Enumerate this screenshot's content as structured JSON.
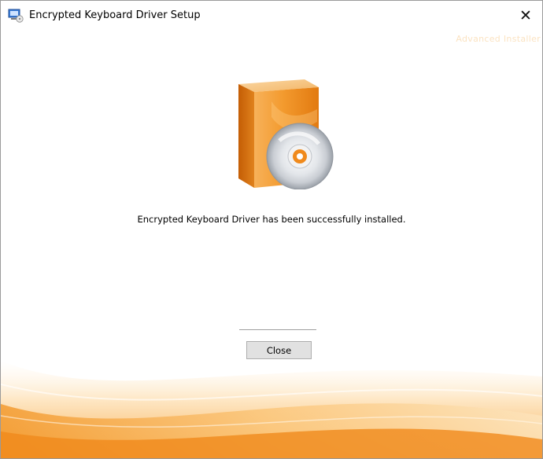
{
  "window": {
    "title": "Encrypted Keyboard Driver Setup",
    "brand_text": "Advanced Installer"
  },
  "main": {
    "message": "Encrypted Keyboard Driver has been successfully installed.",
    "close_button_label": "Close"
  },
  "icons": {
    "app": "setup-app-icon",
    "close": "close-icon",
    "illustration": "software-box-with-cd-icon"
  },
  "colors": {
    "accent_orange": "#f08a1c",
    "brand_text": "#fbe3c2",
    "button_face": "#e1e1e1"
  }
}
